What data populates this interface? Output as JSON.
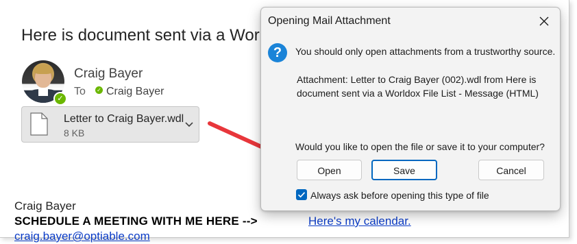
{
  "email": {
    "subject": "Here is document sent via a Wor",
    "sender": {
      "name": "Craig Bayer"
    },
    "to": {
      "label": "To",
      "recipient": "Craig Bayer"
    },
    "attachment": {
      "name": "Letter to Craig Bayer.wdl",
      "size": "8 KB"
    },
    "signature": {
      "name": "Craig Bayer",
      "cta": "SCHEDULE A MEETING WITH ME HERE -->",
      "link_text": "Here's my calendar.",
      "email": "craig.bayer@optiable.com"
    }
  },
  "dialog": {
    "title": "Opening Mail Attachment",
    "warning": "You should only open attachments from a trustworthy source.",
    "attachment_info": "Attachment: Letter to Craig Bayer (002).wdl from Here is document sent via a Worldox File List - Message (HTML)",
    "question": "Would you like to open the file or save it to your computer?",
    "buttons": {
      "open": "Open",
      "save": "Save",
      "cancel": "Cancel"
    },
    "checkbox": {
      "label": "Always ask before opening this type of file",
      "checked": true
    }
  },
  "colors": {
    "accent": "#0067c0",
    "info_icon": "#1b84d8",
    "presence": "#6bb700",
    "arrow": "#e8363b",
    "link": "#0b3cc7"
  },
  "icons": {
    "close": "close-icon",
    "info": "question-icon",
    "file": "file-icon",
    "chevron": "chevron-down-icon",
    "presence": "presence-available-icon",
    "checkbox": "checkmark-icon"
  }
}
